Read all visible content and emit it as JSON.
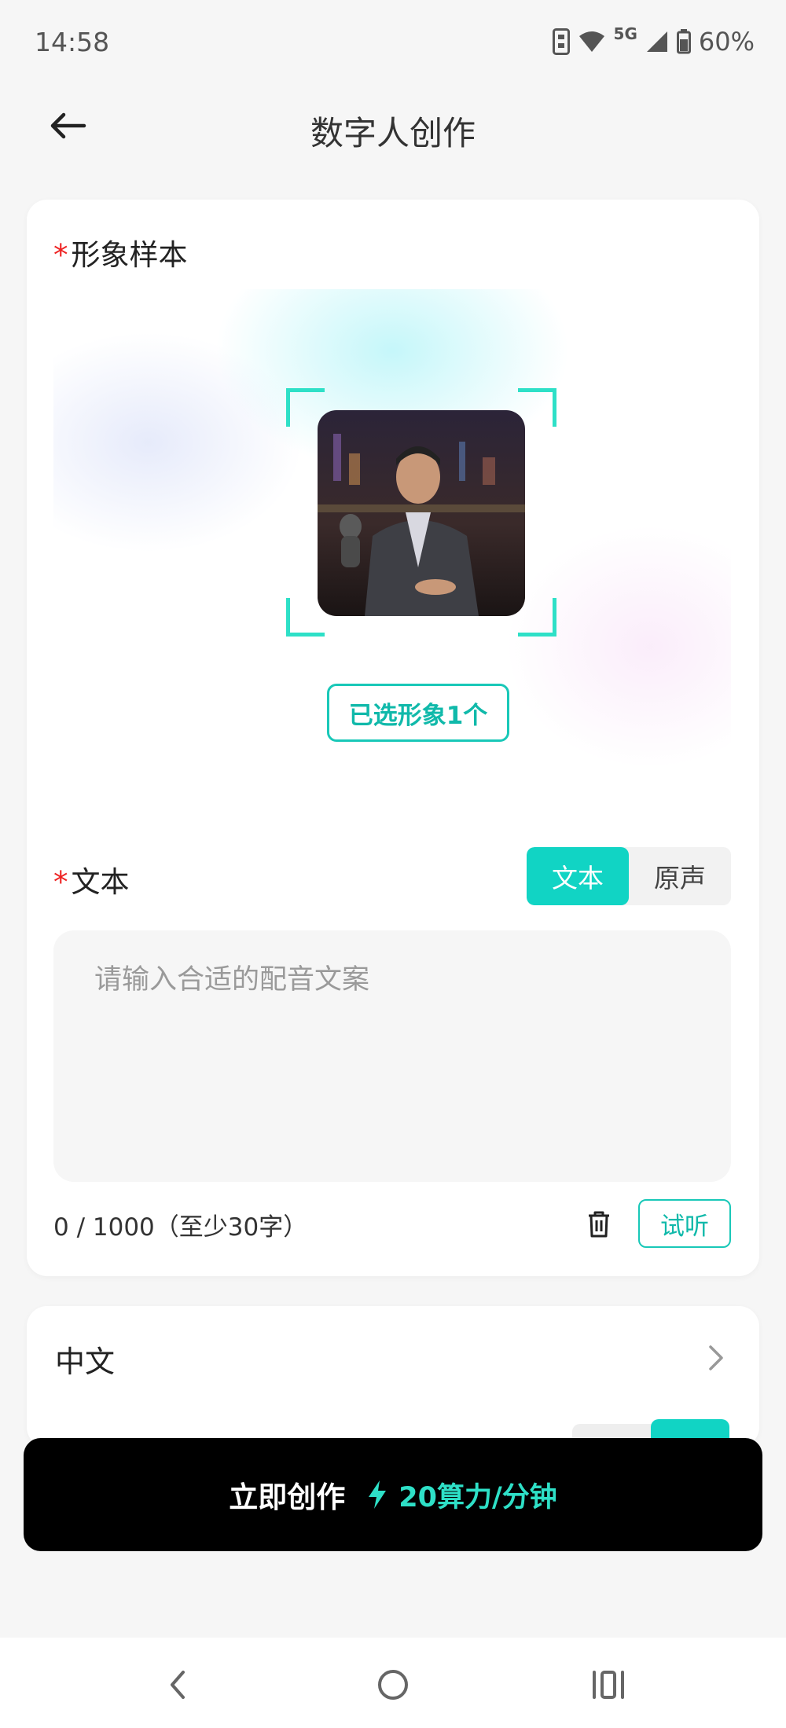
{
  "status_bar": {
    "time": "14:58",
    "network": "5G",
    "battery": "60%",
    "icons": [
      "sim-icon",
      "wifi-icon",
      "signal-icon",
      "battery-icon"
    ]
  },
  "header": {
    "title": "数字人创作",
    "back_icon": "arrow-left-icon"
  },
  "sample_section": {
    "required_mark": "*",
    "label": "形象样本",
    "selected_button": "已选形象1个"
  },
  "text_section": {
    "required_mark": "*",
    "label": "文本",
    "mode_tabs": [
      "文本",
      "原声"
    ],
    "active_tab": "文本",
    "input_value": "",
    "input_placeholder": "请输入合适的配音文案",
    "char_count": "0 / 1000（至少30字）",
    "listen_button": "试听"
  },
  "language": {
    "label": "中文"
  },
  "create_bar": {
    "label": "立即创作",
    "cost": "20算力/分钟"
  },
  "colors": {
    "accent": "#11d4c4",
    "accent_text": "#10b9aa",
    "frame": "#2ee0c7",
    "required": "#ee2222",
    "create_bg": "#000000"
  }
}
